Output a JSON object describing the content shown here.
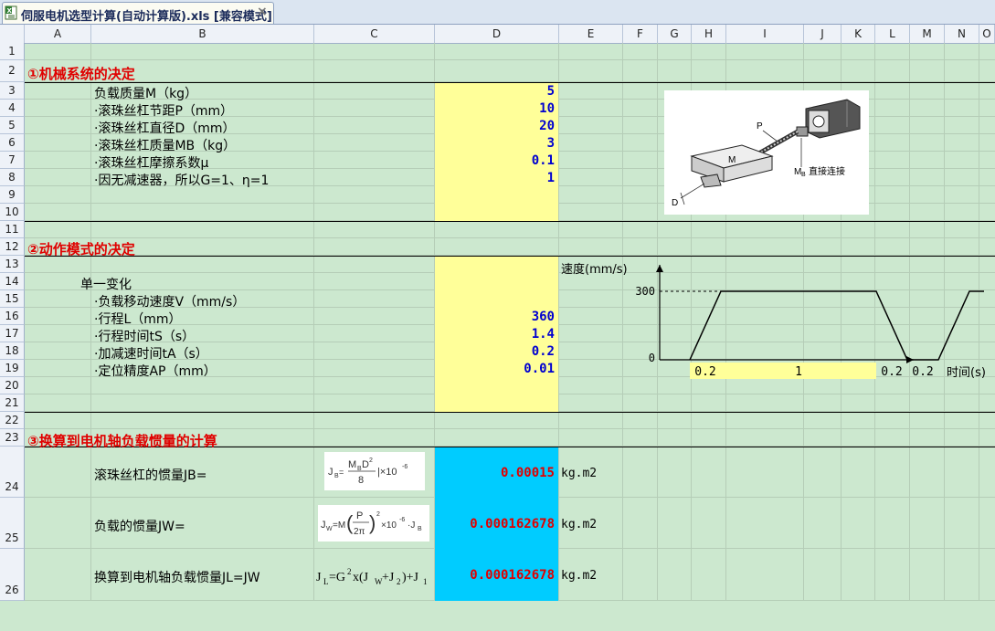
{
  "window": {
    "file_title": "伺服电机选型计算(自动计算版).xls  [兼容模式]",
    "close_label": "×"
  },
  "columns": [
    "A",
    "B",
    "C",
    "D",
    "E",
    "F",
    "G",
    "H",
    "I",
    "J",
    "K",
    "L",
    "M",
    "N",
    "O"
  ],
  "rows": [
    "1",
    "2",
    "3",
    "4",
    "5",
    "6",
    "7",
    "8",
    "9",
    "10",
    "11",
    "12",
    "13",
    "14",
    "15",
    "16",
    "17",
    "18",
    "19",
    "20",
    "21",
    "22",
    "23",
    "24",
    "25",
    "26"
  ],
  "section1": {
    "title": "①机械系统的决定",
    "items": [
      {
        "label": "负载质量M（kg）",
        "value": "5"
      },
      {
        "label": "·滚珠丝杠节距P（mm）",
        "value": "10"
      },
      {
        "label": "·滚珠丝杠直径D（mm）",
        "value": "20"
      },
      {
        "label": "·滚珠丝杠质量MB（kg）",
        "value": "3"
      },
      {
        "label": "·滚珠丝杠摩擦系数μ",
        "value": "0.1"
      },
      {
        "label": "·因无减速器，所以G=1、η=1",
        "value": "1"
      }
    ],
    "figure": {
      "label_p": "P",
      "label_m": "M",
      "label_d": "D",
      "label_mb": "M",
      "label_mb_sub": "B",
      "label_direct": "直接连接"
    }
  },
  "section2": {
    "title": "②动作模式的决定",
    "mode": "单一变化",
    "items": [
      {
        "label": "·负载移动速度V（mm/s）",
        "value": ""
      },
      {
        "label": "·行程L（mm）",
        "value": "360"
      },
      {
        "label": "·行程时间tS（s）",
        "value": "1.4"
      },
      {
        "label": "·加减速时间tA（s）",
        "value": "0.2"
      },
      {
        "label": "·定位精度AP（mm）",
        "value": "0.01"
      }
    ],
    "chart": {
      "ylabel": "速度(mm/s)",
      "xlabel": "时间(s)",
      "y_ticks": [
        "300",
        "0"
      ],
      "x_segments": [
        "0.2",
        "1",
        "0.2",
        "0.2"
      ]
    }
  },
  "section3": {
    "title": "③换算到电机轴负载惯量的计算",
    "rows": [
      {
        "label": "滚珠丝杠的惯量JB=",
        "value": "0.00015",
        "unit": "kg.m2"
      },
      {
        "label": "负载的惯量JW=",
        "value": "0.000162678",
        "unit": "kg.m2"
      },
      {
        "label": "换算到电机轴负载惯量JL=JW",
        "value": "0.000162678",
        "unit": "kg.m2"
      }
    ],
    "formula_jl": {
      "j": "J",
      "l": "L",
      "eq": "=G",
      "two": "2",
      "mid": "x(J",
      "w": "W",
      "plus": "+J",
      "t2": "2",
      "close": ")+J",
      "one": "1"
    },
    "formula_jb": {
      "j": "J",
      "b": "B",
      "eq": "=",
      "mb": "M",
      "mb_sub": "B",
      "d": "D",
      "d_sup": "2",
      "den": "8",
      "times": "|×10",
      "exp": "-6"
    },
    "formula_jw": {
      "j": "J",
      "w": "W",
      "eq": "=M",
      "p": "P",
      "den": "2π",
      "sq": "2",
      "times": "×10",
      "exp": "-6",
      "tail": "·J",
      "tail_sub": "B"
    }
  },
  "chart_data": {
    "type": "line",
    "title": "",
    "xlabel": "时间(s)",
    "ylabel": "速度(mm/s)",
    "x": [
      0,
      0.2,
      1.2,
      1.4,
      1.6,
      1.8
    ],
    "series": [
      {
        "values": [
          0,
          300,
          300,
          0,
          0,
          300
        ]
      }
    ],
    "ylim": [
      0,
      300
    ],
    "segment_labels": [
      "0.2",
      "1",
      "0.2",
      "0.2"
    ]
  }
}
